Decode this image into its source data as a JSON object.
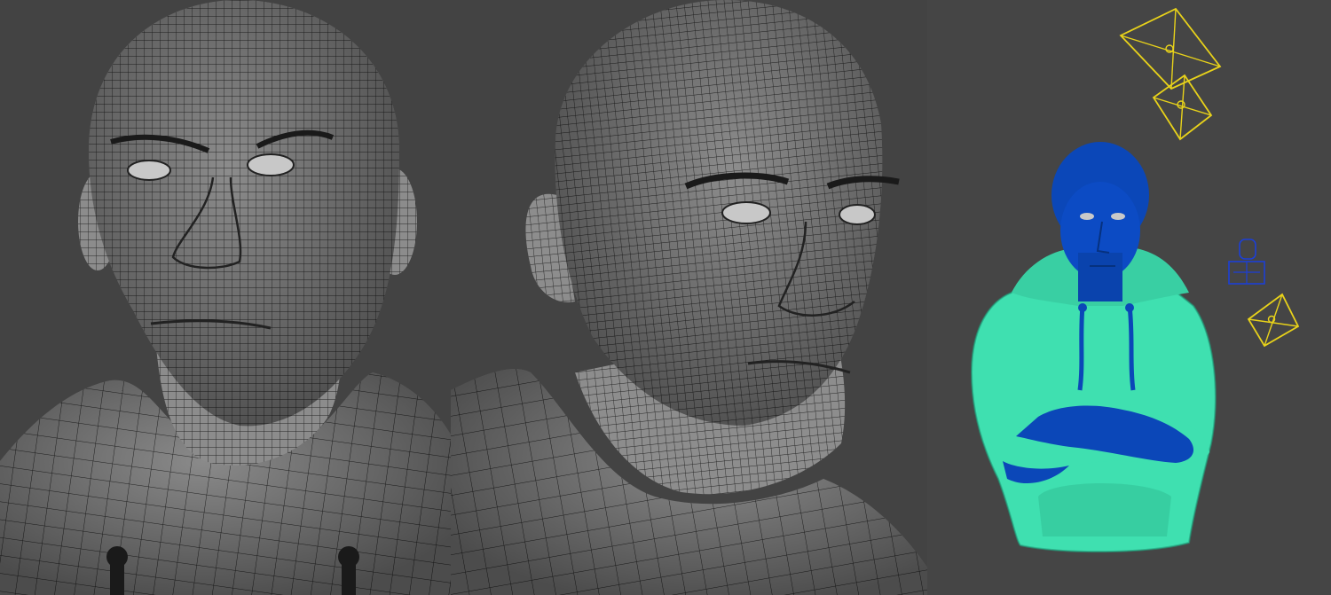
{
  "viewport": {
    "background_color": "#454545",
    "mesh_color": "#8a8a8a",
    "wire_color": "#2a2a2a",
    "hoodie_color": "#3fe0b0",
    "body_color": "#0b47b8",
    "camera_color": "#e8d21a",
    "light_color": "#1c3fd6"
  },
  "panels": [
    {
      "name": "wireframe-front-view"
    },
    {
      "name": "wireframe-three-quarter-view"
    },
    {
      "name": "shaded-full-bust-view"
    }
  ],
  "scene_objects": {
    "cameras": 3,
    "lights": 1
  }
}
